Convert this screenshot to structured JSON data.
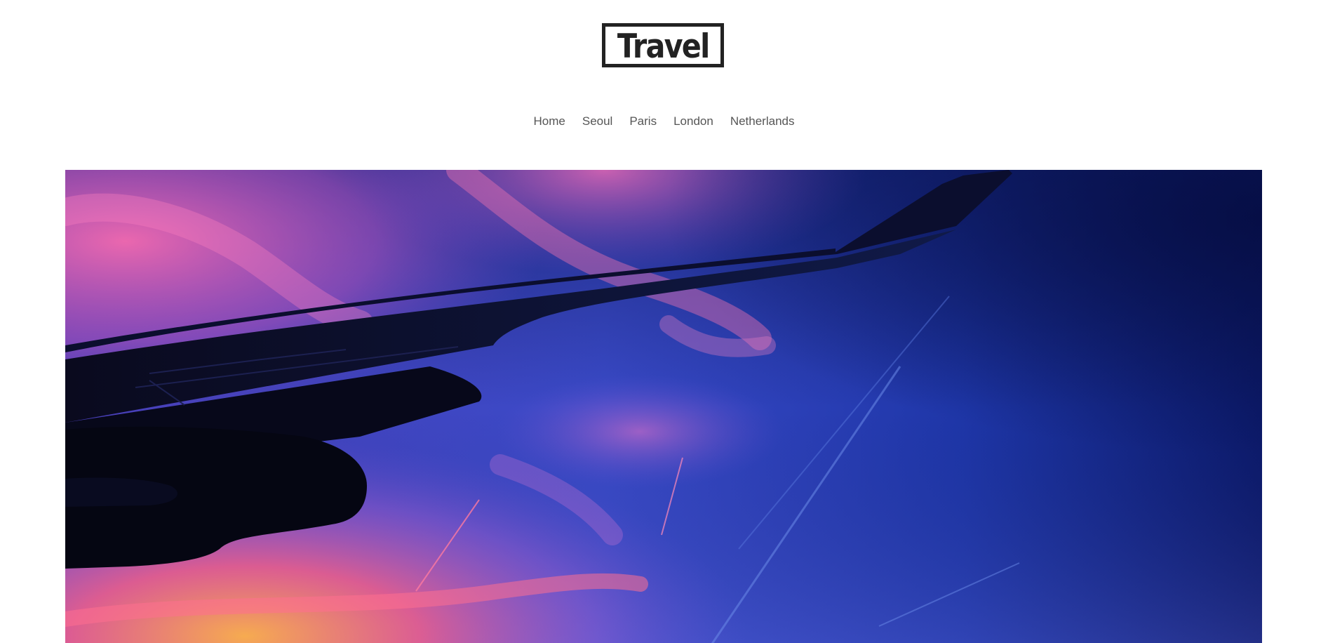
{
  "header": {
    "logo_text": "Travel"
  },
  "nav": {
    "items": [
      {
        "label": "Home"
      },
      {
        "label": "Seoul"
      },
      {
        "label": "Paris"
      },
      {
        "label": "London"
      },
      {
        "label": "Netherlands"
      }
    ]
  },
  "hero": {
    "image_subject": "airplane-wing-at-sunset",
    "colors": {
      "sky_deep": "#0a1860",
      "sky_blue": "#1e3ab0",
      "sky_violet": "#5a5ad0",
      "cloud_pink": "#f06aa8",
      "cloud_orange": "#f7a24a",
      "wing_silhouette": "#07081a"
    }
  }
}
